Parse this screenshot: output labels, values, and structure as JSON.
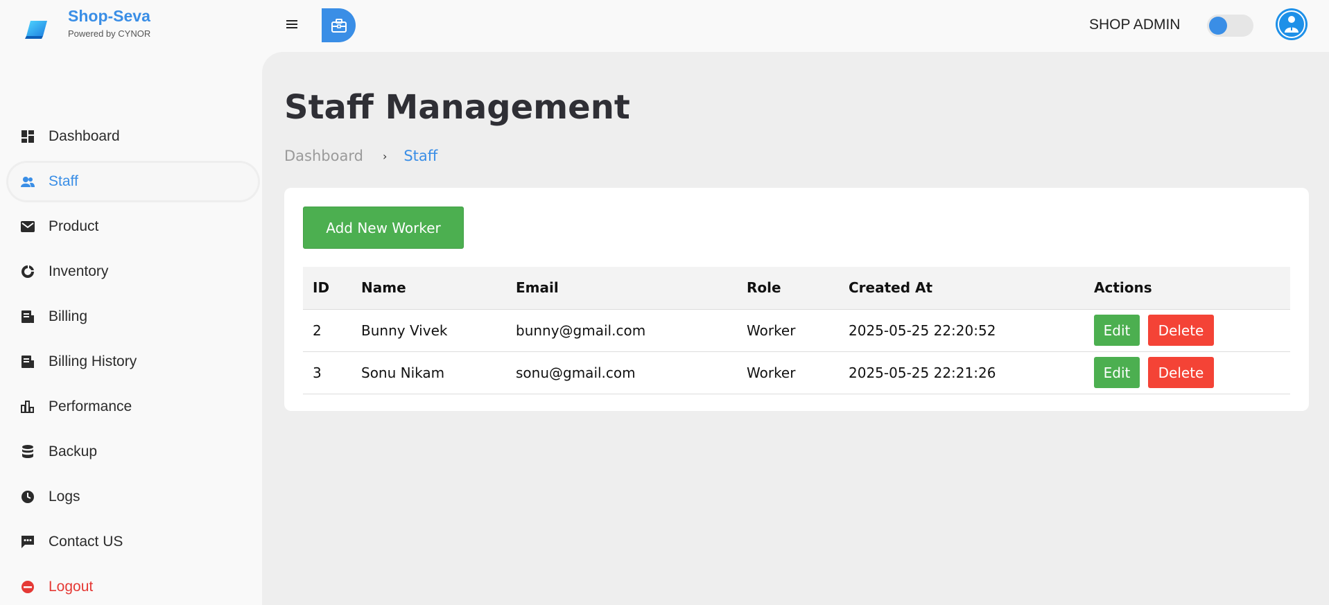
{
  "brand": {
    "name": "Shop-Seva",
    "subtitle": "Powered by CYNOR"
  },
  "header": {
    "role_label": "SHOP ADMIN"
  },
  "sidebar": {
    "items": [
      {
        "label": "Dashboard",
        "icon": "dashboard-icon"
      },
      {
        "label": "Staff",
        "icon": "people-icon",
        "active": true
      },
      {
        "label": "Product",
        "icon": "mail-icon"
      },
      {
        "label": "Inventory",
        "icon": "donut-icon"
      },
      {
        "label": "Billing",
        "icon": "receipt-icon"
      },
      {
        "label": "Billing History",
        "icon": "receipt-icon"
      },
      {
        "label": "Performance",
        "icon": "bar-chart-icon"
      },
      {
        "label": "Backup",
        "icon": "database-icon"
      },
      {
        "label": "Logs",
        "icon": "clock-icon"
      },
      {
        "label": "Contact US",
        "icon": "chat-icon"
      },
      {
        "label": "Logout",
        "icon": "logout-icon"
      }
    ]
  },
  "main": {
    "title": "Staff Management",
    "breadcrumb": {
      "home": "Dashboard",
      "separator": "›",
      "current": "Staff"
    },
    "add_button": "Add New Worker",
    "table": {
      "headers": [
        "ID",
        "Name",
        "Email",
        "Role",
        "Created At",
        "Actions"
      ],
      "rows": [
        {
          "id": "2",
          "name": "Bunny Vivek",
          "email": "bunny@gmail.com",
          "role": "Worker",
          "created": "2025-05-25 22:20:52",
          "edit": "Edit",
          "delete": "Delete"
        },
        {
          "id": "3",
          "name": "Sonu Nikam",
          "email": "sonu@gmail.com",
          "role": "Worker",
          "created": "2025-05-25 22:21:26",
          "edit": "Edit",
          "delete": "Delete"
        }
      ]
    }
  },
  "colors": {
    "accent": "#3a8ee6",
    "success": "#4caf50",
    "danger": "#f44336",
    "logout": "#e53935"
  }
}
